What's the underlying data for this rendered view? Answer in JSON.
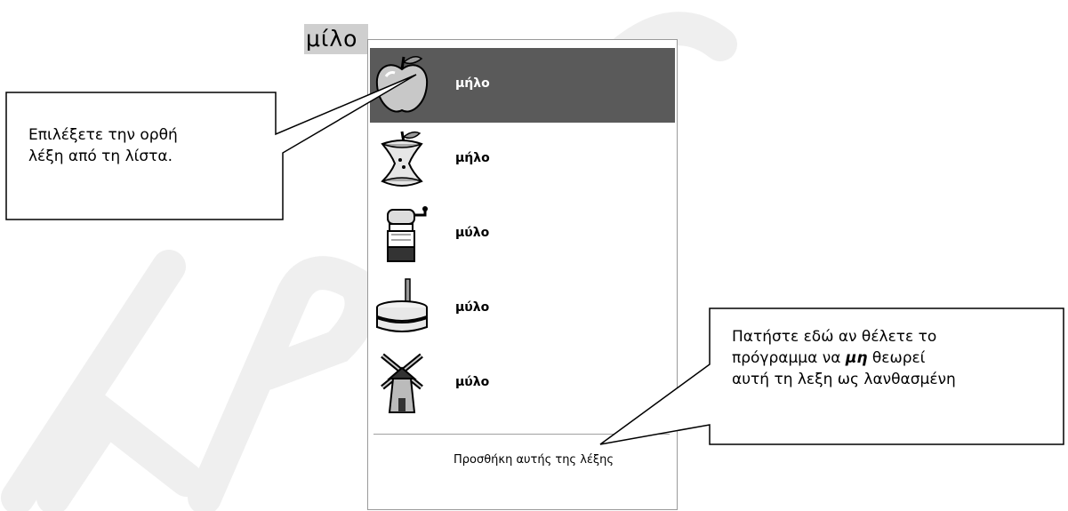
{
  "misspelled_word": "μίλο",
  "suggestions": [
    {
      "word": "μήλο",
      "icon": "apple-icon",
      "selected": true
    },
    {
      "word": "μήλο",
      "icon": "apple-core-icon",
      "selected": false
    },
    {
      "word": "μύλο",
      "icon": "coffee-grinder-icon",
      "selected": false
    },
    {
      "word": "μύλο",
      "icon": "millstone-icon",
      "selected": false
    },
    {
      "word": "μύλο",
      "icon": "windmill-icon",
      "selected": false
    }
  ],
  "add_word_label": "Προσθήκη αυτής της λέξης",
  "callout_left": {
    "line1": "Επιλέξετε την ορθή",
    "line2": "λέξη από τη λίστα."
  },
  "callout_right": {
    "line1": "Πατήστε εδώ αν θέλετε το",
    "line2_prefix": "πρόγραμμα να ",
    "line2_emphasis": "μη",
    "line2_suffix": " θεωρεί",
    "line3": "αυτή τη λεξη ως λανθασμένη"
  },
  "colors": {
    "selected_row": "#5a5a5a",
    "watermark": "#eeeeee"
  }
}
